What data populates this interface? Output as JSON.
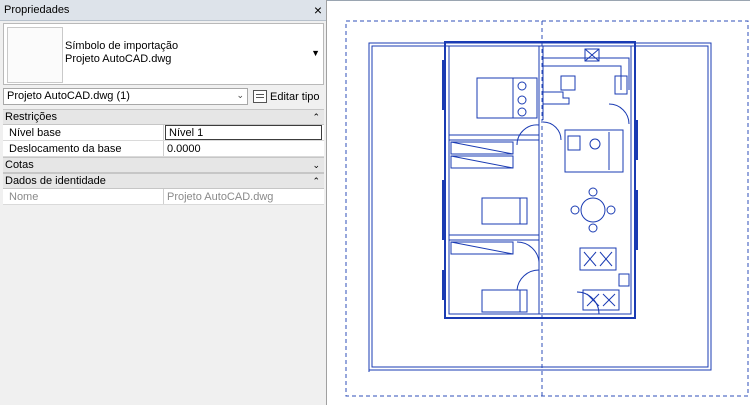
{
  "panel": {
    "title": "Propriedades",
    "close_symbol": "×",
    "type_line1": "Símbolo de importação",
    "type_line2": "Projeto AutoCAD.dwg",
    "instance_selector": "Projeto AutoCAD.dwg (1)",
    "edit_type_label": "Editar tipo"
  },
  "categories": {
    "restricoes": "Restrições",
    "cotas": "Cotas",
    "dados": "Dados de identidade"
  },
  "params": {
    "nivel_base_label": "Nível base",
    "nivel_base_value": "Nível 1",
    "deslocamento_label": "Deslocamento da base",
    "deslocamento_value": "0.0000",
    "nome_label": "Nome",
    "nome_value": "Projeto AutoCAD.dwg"
  },
  "icons": {
    "collapse": "⌃",
    "expand": "⌄",
    "dropdown": "▼"
  },
  "colors": {
    "drawing_blue": "#1a3bb3",
    "selection_dash": "#2f4fb8",
    "header_bg": "#dde3ea"
  }
}
